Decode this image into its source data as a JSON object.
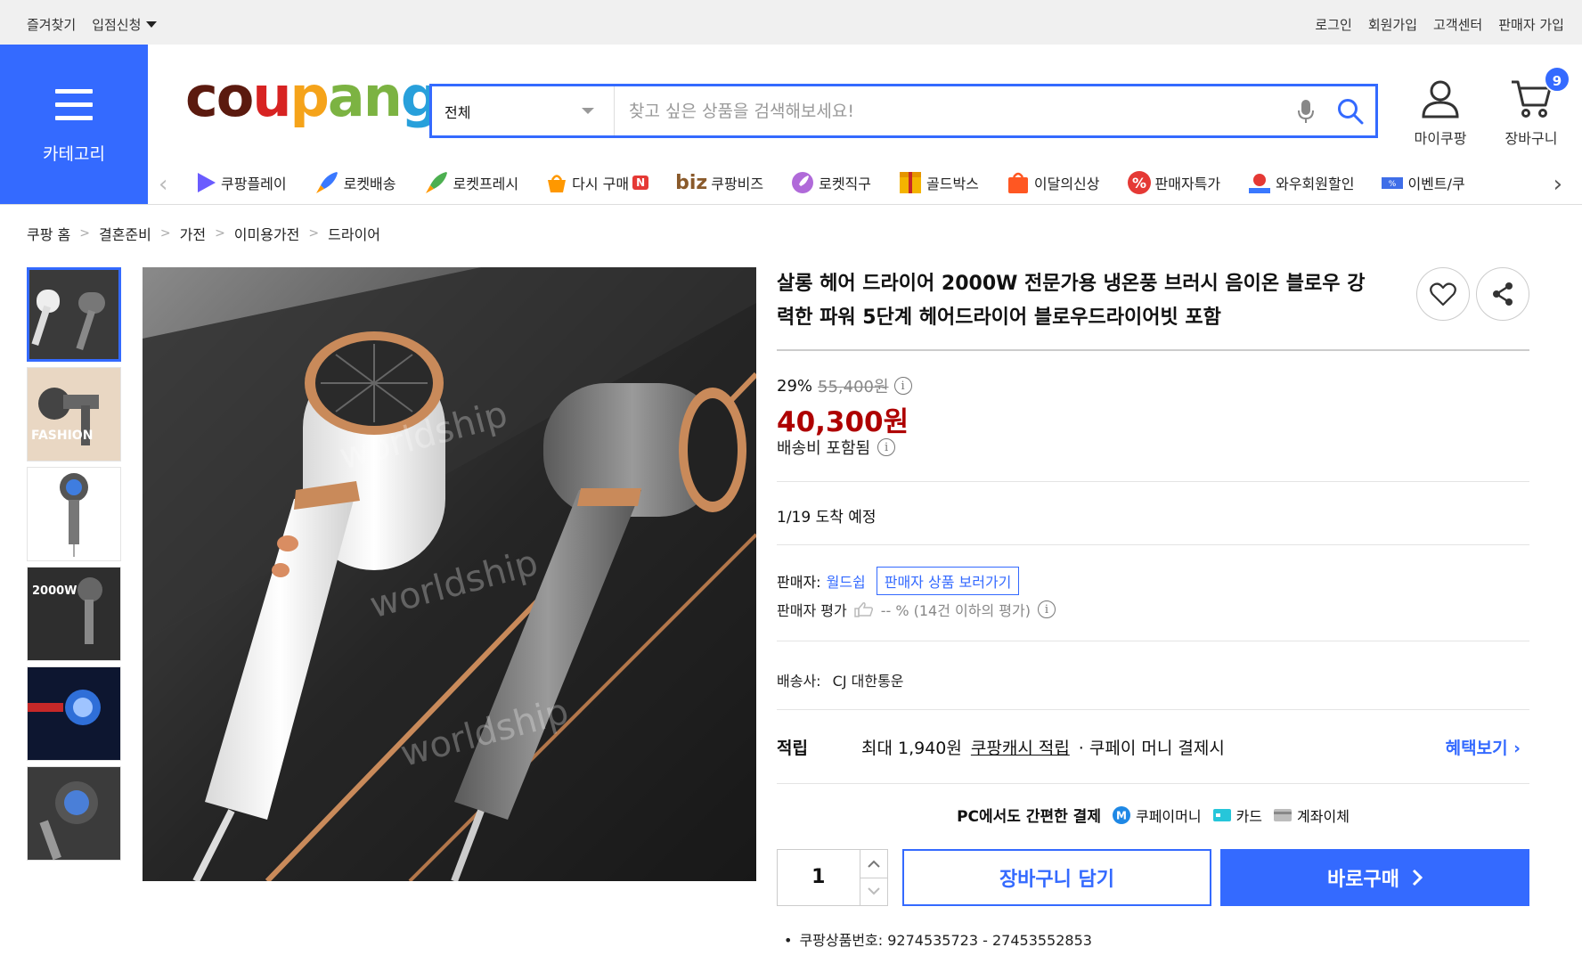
{
  "topbar": {
    "favorites": "즐겨찾기",
    "partner_apply": "입점신청",
    "login": "로그인",
    "signup": "회원가입",
    "customer_center": "고객센터",
    "seller_signup": "판매자 가입"
  },
  "header": {
    "category_label": "카테고리",
    "logo_parts": [
      "co",
      "u",
      "p",
      "an",
      "g"
    ],
    "search_category": "전체",
    "search_placeholder": "찾고 싶은 상품을 검색해보세요!",
    "my_coupang": "마이쿠팡",
    "cart": "장바구니",
    "cart_count": "9",
    "accent_color": "#346aff"
  },
  "nav": {
    "items": [
      {
        "label": "쿠팡플레이",
        "icon": "play-icon",
        "color": "#6a5cff"
      },
      {
        "label": "로켓배송",
        "icon": "rocket-icon",
        "color": "#3a78ff"
      },
      {
        "label": "로켓프레시",
        "icon": "rocket-fresh-icon",
        "color": "#4caf50"
      },
      {
        "label": "다시 구매",
        "icon": "rebuy-icon",
        "color": "#ff9800"
      },
      {
        "label": "쿠팡비즈",
        "icon": "biz-icon",
        "color": "#8a5a2b"
      },
      {
        "label": "로켓직구",
        "icon": "rocket-global-icon",
        "color": "#9c27b0"
      },
      {
        "label": "골드박스",
        "icon": "goldbox-icon",
        "color": "#f4b400"
      },
      {
        "label": "이달의신상",
        "icon": "new-bag-icon",
        "color": "#ff5722"
      },
      {
        "label": "판매자특가",
        "icon": "percent-icon",
        "color": "#e53935"
      },
      {
        "label": "와우회원할인",
        "icon": "wow-icon",
        "color": "#e53935"
      },
      {
        "label": "이벤트/쿠",
        "icon": "coupon-icon",
        "color": "#3f6ee8"
      }
    ],
    "rebuy_badge": "N",
    "biz_prefix": "biz"
  },
  "breadcrumb": [
    "쿠팡 홈",
    "결혼준비",
    "가전",
    "이미용가전",
    "드라이어"
  ],
  "product": {
    "title": "살롱 헤어 드라이어 2000W 전문가용 냉온풍 브러시 음이온 블로우 강력한 파워 5단계 헤어드라이어 블로우드라이어빗 포함",
    "discount_rate": "29%",
    "original_price": "55,400원",
    "price": "40,300원",
    "shipping": "배송비 포함됨",
    "arrival": "1/19 도착 예정",
    "seller_label": "판매자:",
    "seller_name": "월드쉽",
    "seller_link": "판매자 상품 보러가기",
    "seller_rating_label": "판매자 평가",
    "seller_rating_value": "-- % (14건 이하의 평가)",
    "carrier_label": "배송사:",
    "carrier_name": "CJ 대한통운",
    "reward_label": "적립",
    "reward_amount": "최대 1,940원",
    "reward_cash": "쿠팡캐시 적립",
    "reward_suffix": "· 쿠페이 머니 결제시",
    "reward_more": "혜택보기",
    "pay_heading": "PC에서도 간편한 결제",
    "pay_methods": [
      "쿠페이머니",
      "카드",
      "계좌이체"
    ],
    "quantity": "1",
    "add_to_cart": "장바구니 담기",
    "buy_now": "바로구매",
    "product_number": "쿠팡상품번호: 9274535723 - 27453552853",
    "price_color": "#ae0000",
    "watermark": "worldship",
    "thumb_text_fashion": "FASHION",
    "thumb_text_2000w": "2000W"
  }
}
